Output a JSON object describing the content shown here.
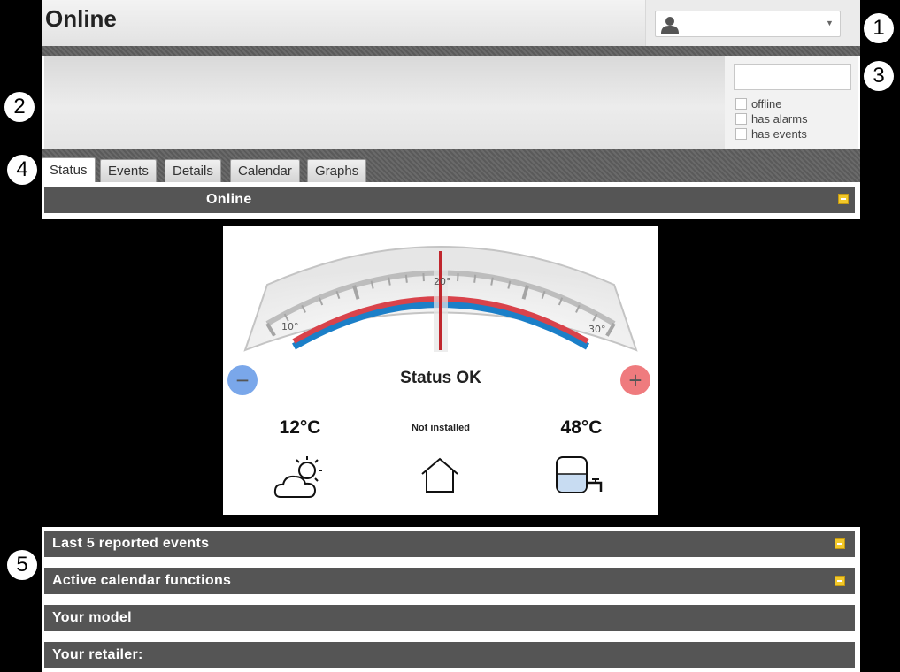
{
  "header": {
    "title": "Online"
  },
  "user_selector": {
    "value": "",
    "icon": "user-icon"
  },
  "filters": {
    "search_placeholder": "",
    "options": [
      {
        "label": "offline",
        "checked": false
      },
      {
        "label": "has alarms",
        "checked": false
      },
      {
        "label": "has events",
        "checked": false
      }
    ]
  },
  "tabs": [
    {
      "label": "Status",
      "active": true
    },
    {
      "label": "Events",
      "active": false
    },
    {
      "label": "Details",
      "active": false
    },
    {
      "label": "Calendar",
      "active": false
    },
    {
      "label": "Graphs",
      "active": false
    }
  ],
  "status_section": {
    "label": "Online"
  },
  "gauge": {
    "min_label": "10°",
    "mid_label": "20°",
    "max_label": "30°",
    "setpoint": 20
  },
  "status": {
    "text": "Status OK",
    "minus": "−",
    "plus": "+"
  },
  "readings": {
    "outdoor": "12°C",
    "indoor": "Not installed",
    "hot_water": "48°C"
  },
  "sections": [
    {
      "label": "Last 5 reported events",
      "collapsible": true
    },
    {
      "label": "Active calendar functions",
      "collapsible": true
    },
    {
      "label": "Your model",
      "collapsible": false
    },
    {
      "label": "Your retailer:",
      "collapsible": false
    }
  ],
  "callouts": [
    "1",
    "2",
    "3",
    "4",
    "5"
  ],
  "colors": {
    "bar": "#555555",
    "minus_button": "#7aa7ea",
    "plus_button": "#ef7b7e",
    "arc_red": "#d9434b",
    "arc_blue": "#1b7fc8",
    "collapse_icon": "#f2c829"
  }
}
